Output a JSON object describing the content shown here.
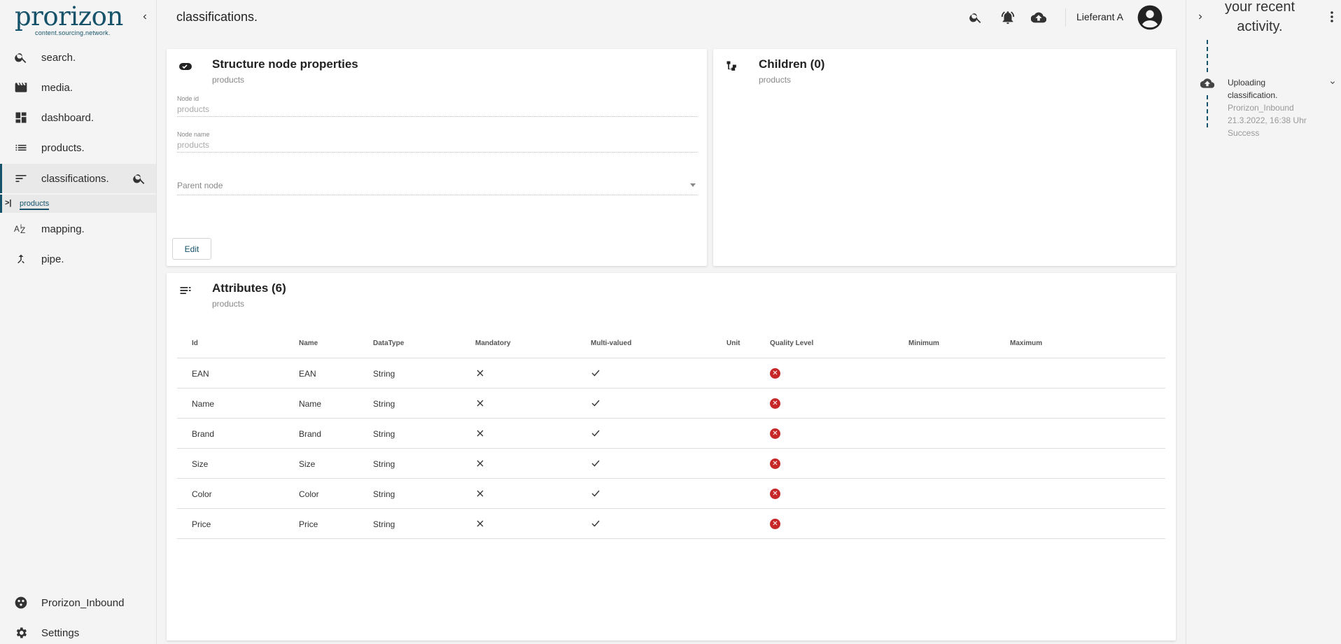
{
  "brand": {
    "logo": "prorizon",
    "tagline": "content.sourcing.network."
  },
  "nav": {
    "items": [
      {
        "label": "search.",
        "icon": "search-icon"
      },
      {
        "label": "media.",
        "icon": "clapperboard-icon"
      },
      {
        "label": "dashboard.",
        "icon": "dashboard-icon"
      },
      {
        "label": "products.",
        "icon": "list-icon"
      },
      {
        "label": "classifications.",
        "icon": "sort-icon"
      },
      {
        "label": "mapping.",
        "icon": "sort-az-icon"
      },
      {
        "label": "pipe.",
        "icon": "merge-icon"
      }
    ],
    "sub_item": "products",
    "bottom": [
      {
        "label": "Prorizon_Inbound",
        "icon": "organization-icon"
      },
      {
        "label": "Settings",
        "icon": "gear-icon"
      }
    ]
  },
  "header": {
    "title": "classifications.",
    "user": "Lieferant A"
  },
  "properties_card": {
    "title": "Structure node properties",
    "subtitle": "products",
    "fields": [
      {
        "label": "Node id",
        "value": "products"
      },
      {
        "label": "Node name",
        "value": "products"
      }
    ],
    "parent_placeholder": "Parent node",
    "edit_label": "Edit"
  },
  "children_card": {
    "title": "Children (0)",
    "subtitle": "products"
  },
  "attributes_card": {
    "title": "Attributes (6)",
    "subtitle": "products",
    "columns": [
      "Id",
      "Name",
      "DataType",
      "Mandatory",
      "Multi-valued",
      "Unit",
      "Quality Level",
      "Minimum",
      "Maximum"
    ],
    "rows": [
      {
        "id": "EAN",
        "name": "EAN",
        "datatype": "String",
        "mandatory": false,
        "multi_valued": true
      },
      {
        "id": "Name",
        "name": "Name",
        "datatype": "String",
        "mandatory": false,
        "multi_valued": true
      },
      {
        "id": "Brand",
        "name": "Brand",
        "datatype": "String",
        "mandatory": false,
        "multi_valued": true
      },
      {
        "id": "Size",
        "name": "Size",
        "datatype": "String",
        "mandatory": false,
        "multi_valued": true
      },
      {
        "id": "Color",
        "name": "Color",
        "datatype": "String",
        "mandatory": false,
        "multi_valued": true
      },
      {
        "id": "Price",
        "name": "Price",
        "datatype": "String",
        "mandatory": false,
        "multi_valued": true
      }
    ]
  },
  "activity_panel": {
    "title": "your recent activity.",
    "items": [
      {
        "title": "Uploading classification.",
        "source": "Prorizon_Inbound",
        "time": "21.3.2022, 16:38 Uhr",
        "status": "Success"
      }
    ]
  },
  "colors": {
    "accent": "#16536a",
    "error": "#c62828"
  }
}
